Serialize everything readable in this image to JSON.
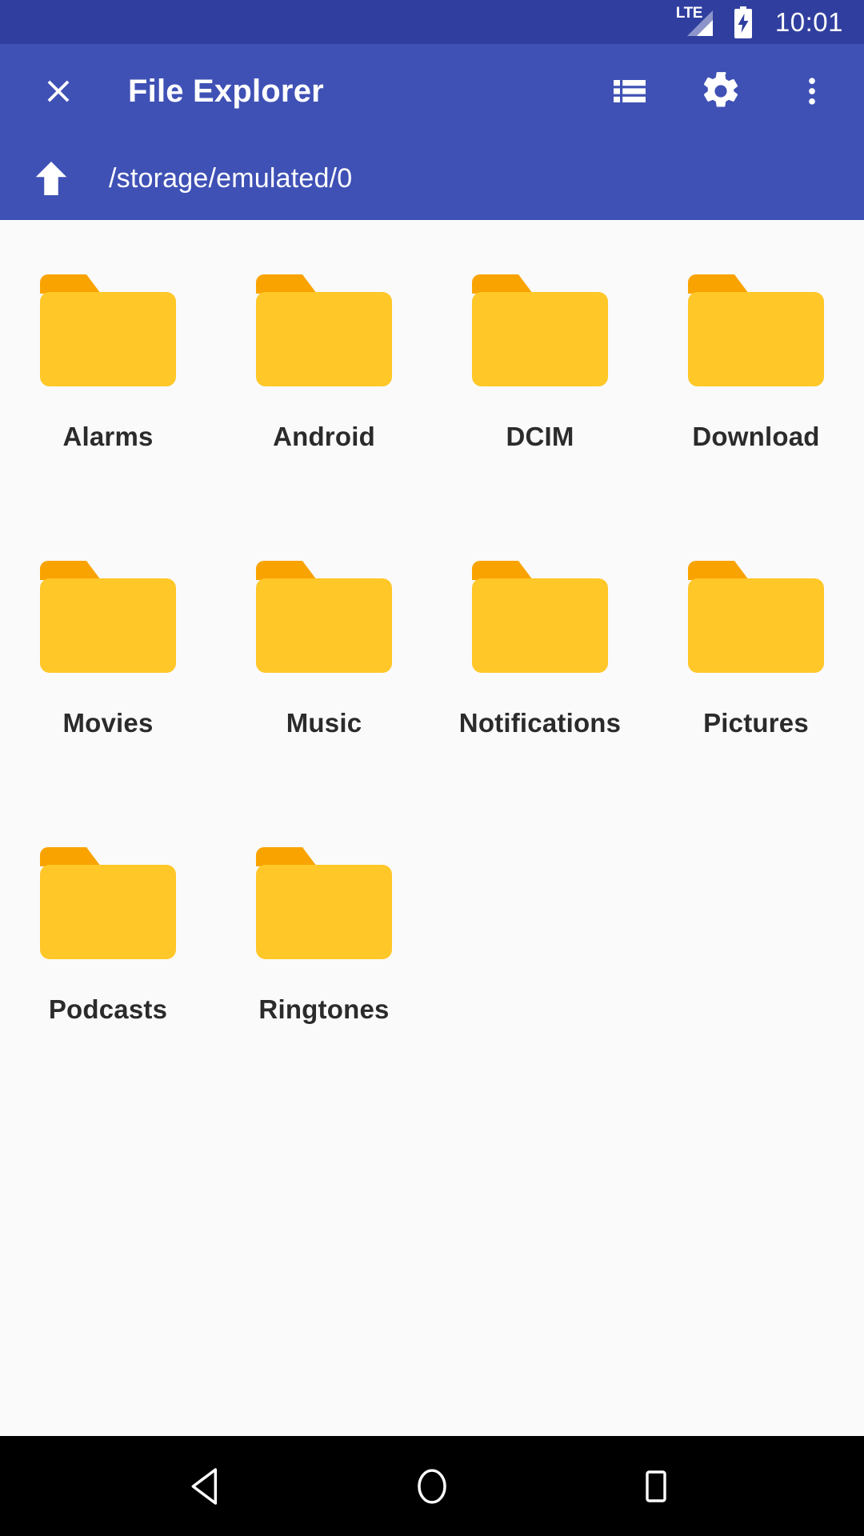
{
  "status_bar": {
    "network_label": "LTE",
    "signal_icon": "signal-cellular-icon",
    "battery_icon": "battery-charging-icon",
    "time": "10:01",
    "background_color": "#303F9F"
  },
  "app_bar": {
    "background_color": "#3F51B5",
    "close_icon": "close-icon",
    "title": "File Explorer",
    "actions": [
      {
        "icon": "list-view-icon",
        "label": "List view"
      },
      {
        "icon": "gear-icon",
        "label": "Settings"
      },
      {
        "icon": "overflow-menu-icon",
        "label": "More options"
      }
    ],
    "path_bar": {
      "up_icon": "arrow-up-icon",
      "path": "/storage/emulated/0"
    }
  },
  "content": {
    "background_color": "#FAFAFA",
    "folder_color_body": "#FFC727",
    "folder_color_tab": "#F9A300",
    "columns": 4,
    "items": [
      {
        "name": "Alarms",
        "type": "folder",
        "icon": "folder-icon"
      },
      {
        "name": "Android",
        "type": "folder",
        "icon": "folder-icon"
      },
      {
        "name": "DCIM",
        "type": "folder",
        "icon": "folder-icon"
      },
      {
        "name": "Download",
        "type": "folder",
        "icon": "folder-icon"
      },
      {
        "name": "Movies",
        "type": "folder",
        "icon": "folder-icon"
      },
      {
        "name": "Music",
        "type": "folder",
        "icon": "folder-icon"
      },
      {
        "name": "Notifications",
        "type": "folder",
        "icon": "folder-icon"
      },
      {
        "name": "Pictures",
        "type": "folder",
        "icon": "folder-icon"
      },
      {
        "name": "Podcasts",
        "type": "folder",
        "icon": "folder-icon"
      },
      {
        "name": "Ringtones",
        "type": "folder",
        "icon": "folder-icon"
      }
    ]
  },
  "nav_bar": {
    "background_color": "#000000",
    "buttons": [
      {
        "icon": "back-icon",
        "label": "Back"
      },
      {
        "icon": "home-icon",
        "label": "Home"
      },
      {
        "icon": "recents-icon",
        "label": "Recent apps"
      }
    ]
  }
}
